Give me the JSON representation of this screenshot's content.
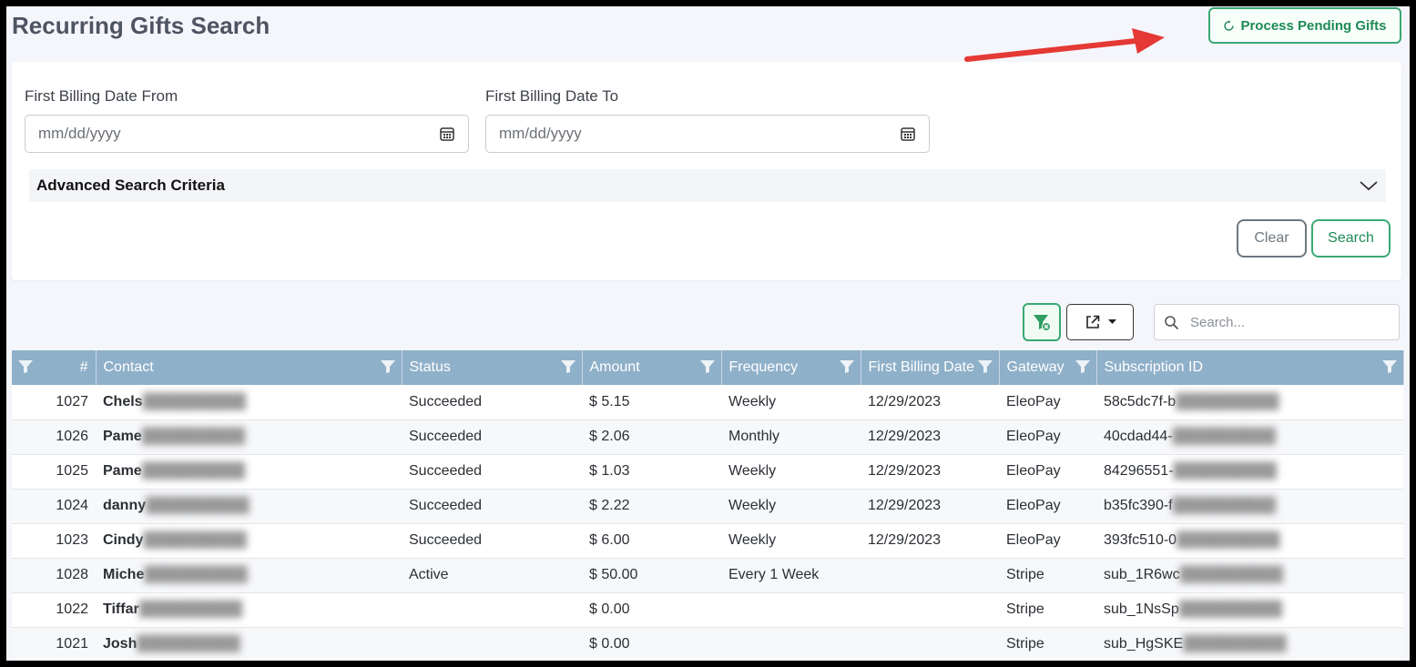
{
  "page": {
    "title": "Recurring Gifts Search",
    "process_button": "Process Pending Gifts"
  },
  "search_form": {
    "from_label": "First Billing Date From",
    "to_label": "First Billing Date To",
    "from_placeholder": "mm/dd/yyyy",
    "to_placeholder": "mm/dd/yyyy",
    "advanced_label": "Advanced Search Criteria",
    "clear_button": "Clear",
    "search_button": "Search"
  },
  "toolbar": {
    "search_placeholder": "Search...",
    "icons": [
      "filter-clear-icon",
      "export-icon",
      "search-icon"
    ]
  },
  "grid": {
    "columns": [
      "#",
      "Contact",
      "Status",
      "Amount",
      "Frequency",
      "First Billing Date",
      "Gateway",
      "Subscription ID"
    ],
    "rows": [
      {
        "num": "1027",
        "contact": "Chels",
        "status": "Succeeded",
        "amount": "$ 5.15",
        "frequency": "Weekly",
        "first_billing": "12/29/2023",
        "gateway": "EleoPay",
        "subscription": "58c5dc7f-b"
      },
      {
        "num": "1026",
        "contact": "Pame",
        "status": "Succeeded",
        "amount": "$ 2.06",
        "frequency": "Monthly",
        "first_billing": "12/29/2023",
        "gateway": "EleoPay",
        "subscription": "40cdad44-"
      },
      {
        "num": "1025",
        "contact": "Pame",
        "status": "Succeeded",
        "amount": "$ 1.03",
        "frequency": "Weekly",
        "first_billing": "12/29/2023",
        "gateway": "EleoPay",
        "subscription": "84296551-"
      },
      {
        "num": "1024",
        "contact": "danny",
        "status": "Succeeded",
        "amount": "$ 2.22",
        "frequency": "Weekly",
        "first_billing": "12/29/2023",
        "gateway": "EleoPay",
        "subscription": "b35fc390-f"
      },
      {
        "num": "1023",
        "contact": "Cindy",
        "status": "Succeeded",
        "amount": "$ 6.00",
        "frequency": "Weekly",
        "first_billing": "12/29/2023",
        "gateway": "EleoPay",
        "subscription": "393fc510-0"
      },
      {
        "num": "1028",
        "contact": "Miche",
        "status": "Active",
        "amount": "$ 50.00",
        "frequency": "Every 1 Week",
        "first_billing": "",
        "gateway": "Stripe",
        "subscription": "sub_1R6wc"
      },
      {
        "num": "1022",
        "contact": "Tiffar",
        "status": "",
        "amount": "$ 0.00",
        "frequency": "",
        "first_billing": "",
        "gateway": "Stripe",
        "subscription": "sub_1NsSp"
      },
      {
        "num": "1021",
        "contact": "Josh",
        "status": "",
        "amount": "$ 0.00",
        "frequency": "",
        "first_billing": "",
        "gateway": "Stripe",
        "subscription": "sub_HgSKE"
      }
    ]
  },
  "colors": {
    "accent_green": "#3aa872",
    "header_blue": "#8fb0c9",
    "arrow_red": "#e53935"
  }
}
